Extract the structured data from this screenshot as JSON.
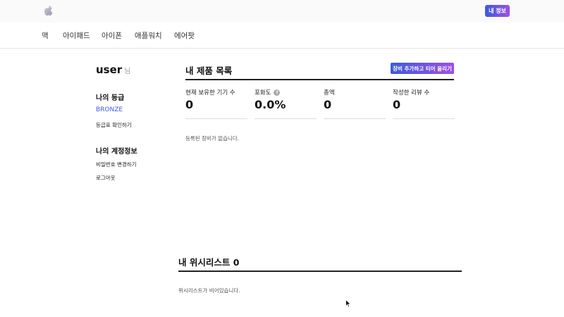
{
  "header": {
    "logo_icon": "apple-logo-icon",
    "myinfo_label": "내 정보"
  },
  "nav": {
    "items": [
      "맥",
      "아이패드",
      "아이폰",
      "애플워치",
      "에어팟"
    ]
  },
  "sidebar": {
    "username": "user",
    "honorific": "님",
    "grade_heading": "나의 등급",
    "grade_value": "BRONZE",
    "grade_table_link": "등급표 확인하기",
    "account_heading": "나의 계정정보",
    "change_password_link": "비밀번호 변경하기",
    "logout_link": "로그아웃"
  },
  "products": {
    "title": "내 제품 목록",
    "add_button": "장비 추가하고 티어 올리기",
    "stats": [
      {
        "label": "현재 보유한 기기 수",
        "value": "0"
      },
      {
        "label": "포화도",
        "value": "0.0%",
        "help_icon": "question-icon",
        "help_glyph": "?"
      },
      {
        "label": "총액",
        "value": "0"
      },
      {
        "label": "작성한 리뷰 수",
        "value": "0"
      }
    ],
    "empty_message": "등록된 장비가 없습니다."
  },
  "wishlist": {
    "title": "내 위시리스트 0",
    "empty_message": "위시리스트가 비어있습니다."
  },
  "colors": {
    "accent_start": "#3b5bdb",
    "accent_end": "#a150e6",
    "grade_color": "#3b5bdb"
  }
}
